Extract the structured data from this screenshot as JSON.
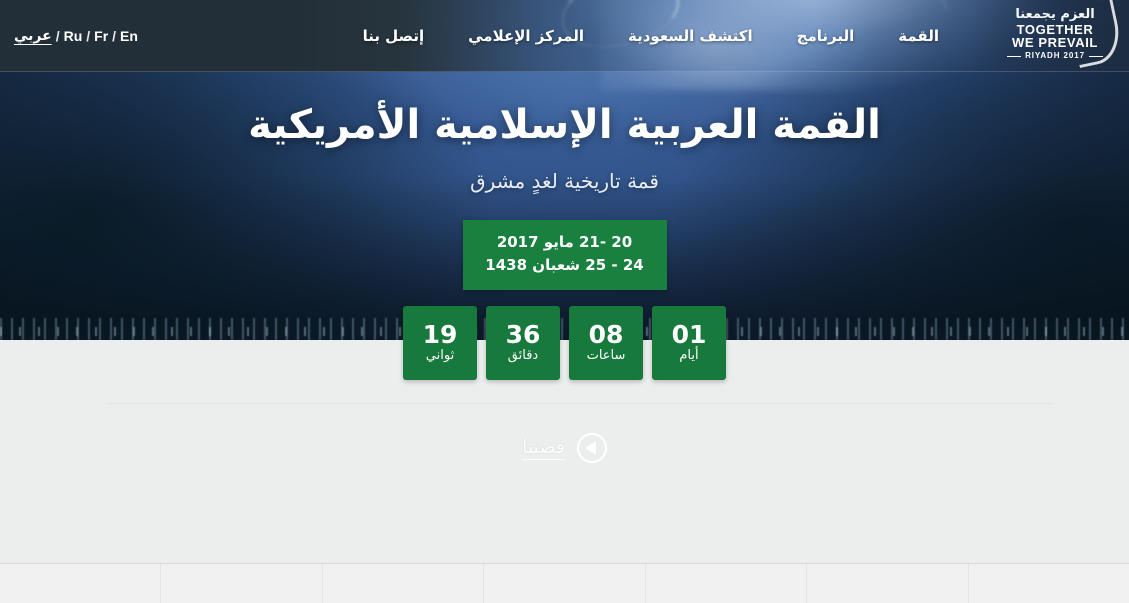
{
  "nav": {
    "items": [
      {
        "label": "القمة"
      },
      {
        "label": "البرنامج"
      },
      {
        "label": "اكتشف السعودية"
      },
      {
        "label": "المركز الإعلامي"
      },
      {
        "label": "إتصل بنا"
      }
    ],
    "languages": [
      {
        "label": "عربي",
        "active": true
      },
      {
        "label": "Ru",
        "active": false
      },
      {
        "label": "Fr",
        "active": false
      },
      {
        "label": "En",
        "active": false
      }
    ],
    "lang_separator": "/"
  },
  "logo": {
    "arabic": "العزم يجمعنا",
    "line1": "TOGETHER",
    "line2": "WE PREVAIL",
    "year": "RIYADH 2017"
  },
  "hero": {
    "title": "القمة العربية الإسلامية الأمريكية",
    "subtitle": "قمة تاريخية لغدٍ مشرق",
    "date_gregorian": "20 -21 مايو 2017",
    "date_hijri": "24 - 25 شعبان 1438"
  },
  "countdown": [
    {
      "value": "01",
      "label": "أيام"
    },
    {
      "value": "08",
      "label": "ساعات"
    },
    {
      "value": "36",
      "label": "دقائق"
    },
    {
      "value": "19",
      "label": "ثواني"
    }
  ],
  "story": {
    "label": "قصتنا"
  },
  "colors": {
    "green_badge": "#1a8040",
    "green_countdown": "#17793c",
    "nav_dark": "#232f38",
    "body_grey": "#eceded",
    "footer_grey": "#f1f1f1"
  }
}
